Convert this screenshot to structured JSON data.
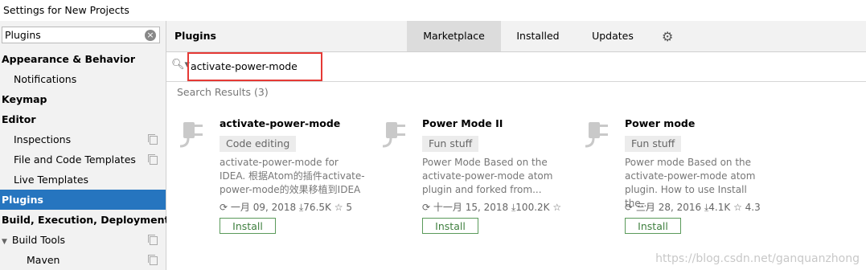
{
  "window": {
    "title": "Settings for New Projects"
  },
  "sidebar": {
    "search_value": "Plugins",
    "items": [
      {
        "label": "Appearance & Behavior"
      },
      {
        "label": "Notifications"
      },
      {
        "label": "Keymap"
      },
      {
        "label": "Editor"
      },
      {
        "label": "Inspections"
      },
      {
        "label": "File and Code Templates"
      },
      {
        "label": "Live Templates"
      },
      {
        "label": "Plugins"
      },
      {
        "label": "Build, Execution, Deployment"
      },
      {
        "label": "Build Tools"
      },
      {
        "label": "Maven"
      }
    ]
  },
  "header": {
    "title": "Plugins",
    "tabs": [
      {
        "label": "Marketplace"
      },
      {
        "label": "Installed"
      },
      {
        "label": "Updates"
      }
    ]
  },
  "search": {
    "value": "activate-power-mode"
  },
  "results_label": "Search Results (3)",
  "plugins": [
    {
      "name": "activate-power-mode",
      "tag": "Code editing",
      "desc": [
        "activate-power-mode for",
        "IDEA. 根据Atom的插件activate-",
        "power-mode的效果移植到IDEA"
      ],
      "date": "一月 09, 2018",
      "downloads": "76.5K",
      "rating": "5",
      "install": "Install"
    },
    {
      "name": "Power Mode II",
      "tag": "Fun stuff",
      "desc": [
        "Power Mode Based on the",
        "activate-power-mode atom",
        "plugin and forked from..."
      ],
      "date": "十一月 15, 2018",
      "downloads": "100.2K",
      "rating": "",
      "install": "Install"
    },
    {
      "name": "Power mode",
      "tag": "Fun stuff",
      "desc": [
        "Power mode Based on the",
        "activate-power-mode atom",
        "plugin. How to use Install the..."
      ],
      "date": "三月 28, 2016",
      "downloads": "4.1K",
      "rating": "4.3",
      "install": "Install"
    }
  ],
  "watermark": "https://blog.csdn.net/ganquanzhong"
}
